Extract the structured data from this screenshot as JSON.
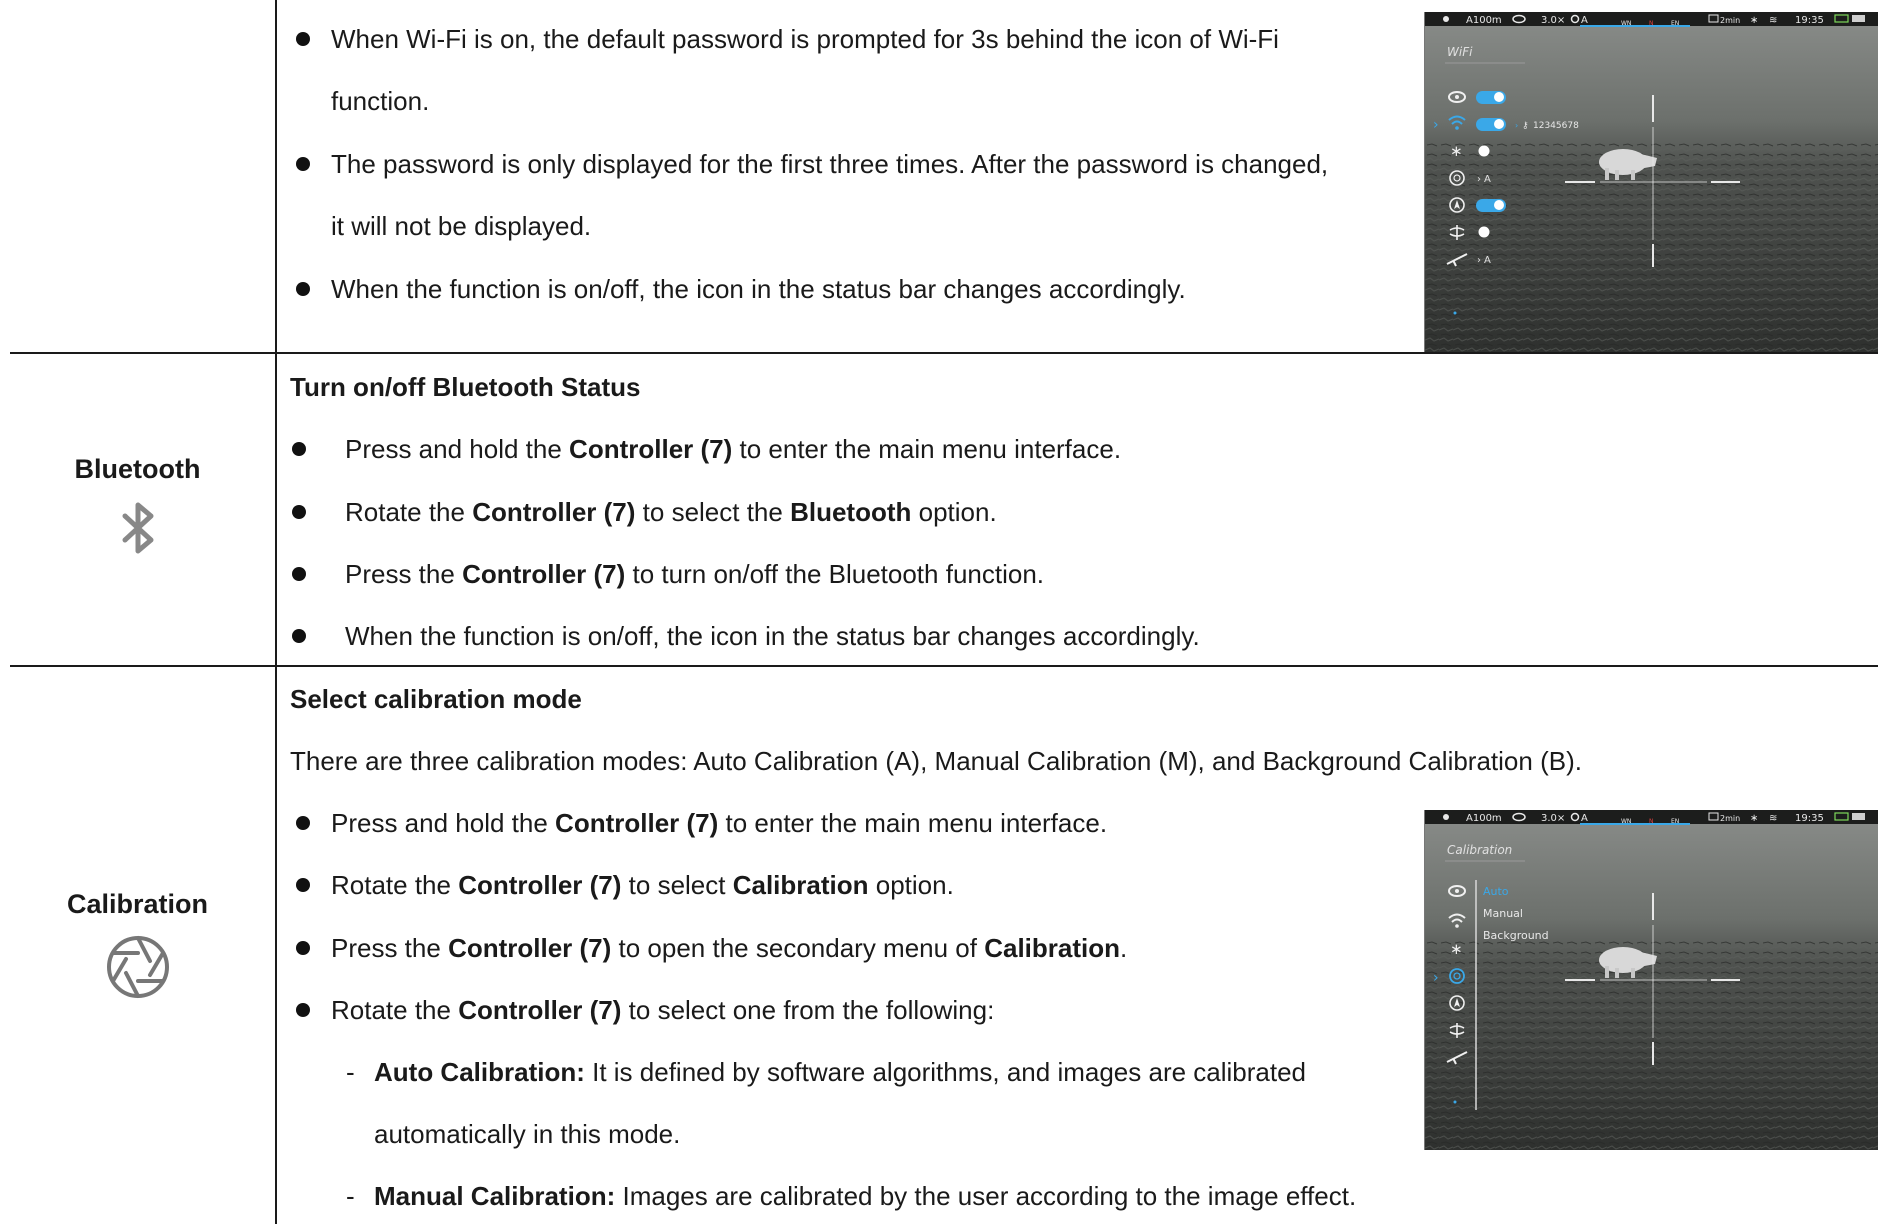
{
  "wifi_section": {
    "bullets": [
      [
        "When Wi-Fi is on, the default password is prompted for 3s behind the icon of Wi-Fi",
        "function."
      ],
      [
        "The password is only displayed for the first three times. After the password is changed,",
        "it will not be displayed."
      ],
      [
        "When the function is on/off, the icon in the status bar changes accordingly."
      ]
    ],
    "device": {
      "status": {
        "range": "A100m",
        "zoom": "3.0×",
        "cal": "A",
        "compass": [
          "WN",
          "N",
          "EN"
        ],
        "timer": "2min",
        "time": "19:35"
      },
      "menu_title": "WiFi",
      "password": "12345678",
      "labels": {
        "cal": "A",
        "rifle": "A"
      },
      "accent": "#3aa8e8"
    }
  },
  "bluetooth_section": {
    "name": "Bluetooth",
    "heading": "Turn on/off Bluetooth Status",
    "bullets": [
      {
        "pre": "Press and hold the ",
        "b1": "Controller (7)",
        "mid": " to enter the main menu interface.",
        "b2": "",
        "post": ""
      },
      {
        "pre": "Rotate the ",
        "b1": "Controller (7)",
        "mid": " to select the ",
        "b2": "Bluetooth",
        "post": " option."
      },
      {
        "pre": "Press the ",
        "b1": "Controller (7)",
        "mid": " to turn on/off the Bluetooth function.",
        "b2": "",
        "post": ""
      },
      {
        "pre": "When the function is on/off, the icon in the status bar changes accordingly.",
        "b1": "",
        "mid": "",
        "b2": "",
        "post": ""
      }
    ]
  },
  "calibration_section": {
    "name": "Calibration",
    "heading": "Select calibration mode",
    "intro": "There are three calibration modes: Auto Calibration (A), Manual Calibration (M), and Background Calibration (B).",
    "bullets": [
      {
        "pre": "Press and hold the ",
        "b1": "Controller (7)",
        "mid": " to enter the main menu interface.",
        "b2": "",
        "post": ""
      },
      {
        "pre": "Rotate the ",
        "b1": "Controller (7)",
        "mid": " to select ",
        "b2": "Calibration",
        "post": " option."
      },
      {
        "pre": "Press the ",
        "b1": "Controller (7)",
        "mid": " to open the secondary menu of ",
        "b2": "Calibration",
        "post": "."
      },
      {
        "pre": "Rotate the ",
        "b1": "Controller (7)",
        "mid": " to select one from the following:",
        "b2": "",
        "post": ""
      }
    ],
    "subitems": [
      {
        "dash": "-",
        "bold": "Auto Calibration:",
        "text": " It is defined by software algorithms, and images are calibrated",
        "cont": "automatically in this mode."
      },
      {
        "dash": "-",
        "bold": "Manual Calibration:",
        "text": " Images are calibrated by the user according to the image effect.",
        "cont": ""
      }
    ],
    "device": {
      "status": {
        "range": "A100m",
        "zoom": "3.0×",
        "cal": "A",
        "compass": [
          "WN",
          "N",
          "EN"
        ],
        "timer": "2min",
        "time": "19:35"
      },
      "menu_title": "Calibration",
      "options": [
        "Auto",
        "Manual",
        "Background"
      ],
      "accent": "#3aa8e8"
    }
  }
}
